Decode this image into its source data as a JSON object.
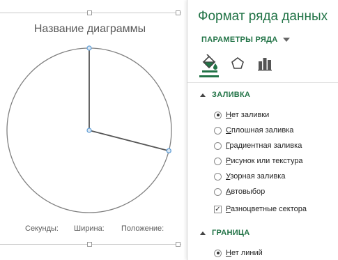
{
  "chart": {
    "title": "Название диаграммы",
    "legend": [
      "Секунды:",
      "Ширина:",
      "Положение:"
    ]
  },
  "pane": {
    "title": "Формат ряда данных",
    "series_options_label": "ПАРАМЕТРЫ РЯДА",
    "tabs": [
      {
        "icon": "paint-bucket-icon",
        "active": true
      },
      {
        "icon": "pentagon-icon",
        "active": false
      },
      {
        "icon": "bar-chart-icon",
        "active": false
      }
    ],
    "fill": {
      "header": "ЗАЛИВКА",
      "options": [
        {
          "hot": "Н",
          "rest": "ет заливки",
          "selected": true
        },
        {
          "hot": "С",
          "rest": "плошная заливка",
          "selected": false
        },
        {
          "hot": "Г",
          "rest": "радиентная заливка",
          "selected": false
        },
        {
          "hot": "Р",
          "rest": "исунок или текстура",
          "selected": false
        },
        {
          "hot": "У",
          "rest": "зорная заливка",
          "selected": false
        },
        {
          "hot": "А",
          "rest": "втовыбор",
          "selected": false
        }
      ],
      "vary_colors": {
        "hot": "Р",
        "rest": "азноцветные сектора",
        "checked": true
      }
    },
    "border": {
      "header": "ГРАНИЦА",
      "options": [
        {
          "hot": "Н",
          "rest": "ет линий",
          "selected": true
        }
      ]
    }
  },
  "colors": {
    "accent": "#217346",
    "pie_line": "#7f7f7f",
    "selection_handle": "#5b9bd5"
  },
  "chart_data": {
    "type": "pie",
    "title": "Название диаграммы",
    "legend": [
      "Секунды:",
      "Ширина:",
      "Положение:"
    ],
    "slices": [
      {
        "label": "Секунды:",
        "share": 0.29
      },
      {
        "label": "",
        "share": 0.71
      }
    ],
    "fill": "none"
  }
}
